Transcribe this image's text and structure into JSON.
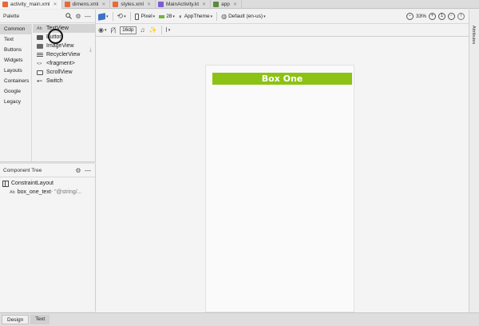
{
  "tabs": [
    {
      "label": "activity_main.xml",
      "color": "#e56b3a"
    },
    {
      "label": "dimens.xml",
      "color": "#e56b3a"
    },
    {
      "label": "styles.xml",
      "color": "#e56b3a"
    },
    {
      "label": "MainActivity.kt",
      "color": "#7d5bd6"
    },
    {
      "label": "app",
      "color": "#5b8a3c"
    }
  ],
  "palette": {
    "title": "Palette",
    "categories": [
      "Common",
      "Text",
      "Buttons",
      "Widgets",
      "Layouts",
      "Containers",
      "Google",
      "Legacy"
    ],
    "widgets": [
      {
        "icon": "Ab",
        "label": "TextView"
      },
      {
        "icon": "",
        "label": "Button"
      },
      {
        "icon": "",
        "label": "ImageView"
      },
      {
        "icon": "",
        "label": "RecyclerView"
      },
      {
        "icon": "<>",
        "label": "<fragment>"
      },
      {
        "icon": "",
        "label": "ScrollView"
      },
      {
        "icon": "",
        "label": "Switch"
      }
    ]
  },
  "component_tree": {
    "title": "Component Tree",
    "root": "ConstraintLayout",
    "child_icon": "Ab",
    "child_label": "box_one_text",
    "child_value": "- \"@string/..."
  },
  "toolbar": {
    "device": "Pixel",
    "api": "28",
    "theme": "AppTheme",
    "locale": "Default (en-us)",
    "zoom": "33%",
    "margin": "16dp"
  },
  "canvas": {
    "box_text": "Box One",
    "box_color": "#8cc214"
  },
  "attributes_label": "Attributes",
  "bottom_tabs": {
    "design": "Design",
    "text": "Text"
  }
}
